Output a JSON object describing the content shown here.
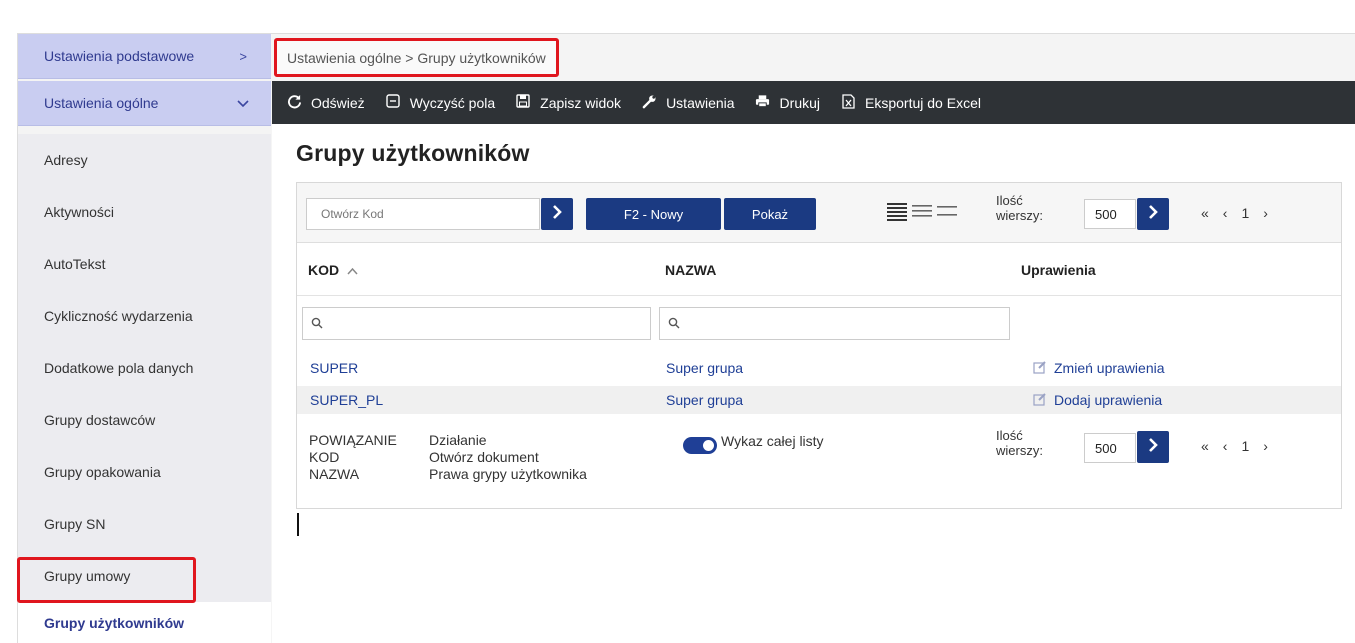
{
  "sidebar": {
    "groups": [
      {
        "label": "Ustawienia podstawowe",
        "chevron": ">"
      },
      {
        "label": "Ustawienia ogólne",
        "chevron": "v"
      }
    ],
    "items": [
      {
        "label": "Adresy"
      },
      {
        "label": "Aktywności"
      },
      {
        "label": "AutoTekst"
      },
      {
        "label": "Cykliczność wydarzenia"
      },
      {
        "label": "Dodatkowe pola danych"
      },
      {
        "label": "Grupy dostawców"
      },
      {
        "label": "Grupy opakowania"
      },
      {
        "label": "Grupy SN"
      },
      {
        "label": "Grupy umowy"
      },
      {
        "label": "Grupy użytkowników",
        "active": true
      }
    ]
  },
  "breadcrumb": {
    "text": "Ustawienia ogólne > Grupy użytkowników"
  },
  "toolbar": {
    "refresh": "Odśwież",
    "clear": "Wyczyść pola",
    "save_view": "Zapisz widok",
    "settings": "Ustawienia",
    "print": "Drukuj",
    "export": "Eksportuj do Excel"
  },
  "page": {
    "title": "Grupy użytkowników"
  },
  "controls": {
    "open_placeholder": "Otwórz Kod",
    "new_button": "F2 - Nowy",
    "show_button": "Pokaż",
    "rows_label_1": "Ilość",
    "rows_label_2": "wierszy:",
    "rows_value": "500",
    "pager_first": "«",
    "pager_prev": "‹",
    "pager_page": "1",
    "pager_next": "›"
  },
  "table": {
    "columns": [
      {
        "label": "KOD",
        "sort": "^"
      },
      {
        "label": "NAZWA"
      },
      {
        "label": "Uprawienia"
      }
    ],
    "rows": [
      {
        "kod": "SUPER",
        "nazwa": "Super grupa",
        "action": "Zmień uprawienia"
      },
      {
        "kod": "SUPER_PL",
        "nazwa": "Super grupa",
        "action": "Dodaj uprawienia"
      }
    ]
  },
  "legend": {
    "keys": [
      "POWIĄZANIE",
      "KOD",
      "NAZWA"
    ],
    "values": [
      "Działanie",
      "Otwórz dokument",
      "Prawa grypy użytkownika"
    ]
  },
  "footer": {
    "toggle_label": "Wykaz całej listy",
    "toggle_on": true,
    "rows_label_1": "Ilość",
    "rows_label_2": "wierszy:",
    "rows_value": "500"
  },
  "colors": {
    "accent": "#1b3a82",
    "sidebar_group": "#c9cdf1",
    "toolbar": "#2e3236",
    "highlight": "#e0161e"
  }
}
